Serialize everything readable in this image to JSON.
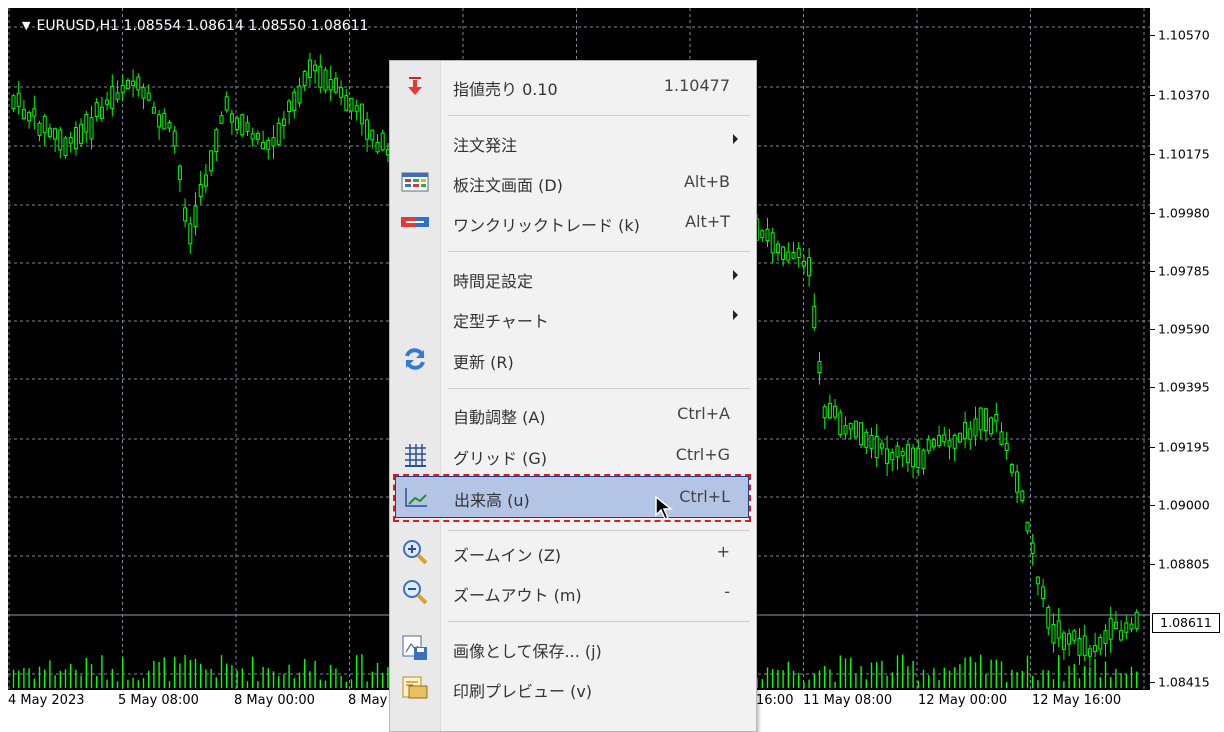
{
  "symbol_info": {
    "text": "EURUSD,H1  1.08554 1.08614 1.08550 1.08611"
  },
  "price_axis": {
    "labels": [
      "1.10570",
      "1.10370",
      "1.10175",
      "1.09980",
      "1.09785",
      "1.09590",
      "1.09395",
      "1.09195",
      "1.09000",
      "1.08805",
      "1.08415"
    ],
    "current_price": "1.08611"
  },
  "time_axis": {
    "labels": [
      "4 May 2023",
      "5 May 08:00",
      "8 May 00:00",
      "8 May",
      "16:00",
      "11 May 08:00",
      "12 May 00:00",
      "12 May 16:00"
    ]
  },
  "colors": {
    "candle": "#00ff00",
    "background": "#000000",
    "grid": "#7a8a99",
    "highlight": "#b4c4e4",
    "highlight_dash": "#e21a1a"
  },
  "menu": {
    "items": [
      {
        "label": "指値売り 0.10",
        "shortcut": "1.10477",
        "icon": "sell-limit-icon"
      },
      {
        "label": "注文発注",
        "submenu": true
      },
      {
        "label": "板注文画面 (D)",
        "shortcut": "Alt+B",
        "icon": "depth-of-market-icon"
      },
      {
        "label": "ワンクリックトレード (k)",
        "shortcut": "Alt+T",
        "icon": "one-click-trade-icon"
      },
      {
        "label": "時間足設定",
        "submenu": true
      },
      {
        "label": "定型チャート",
        "submenu": true
      },
      {
        "label": "更新 (R)",
        "icon": "refresh-icon"
      },
      {
        "label": "自動調整 (A)",
        "shortcut": "Ctrl+A"
      },
      {
        "label": "グリッド (G)",
        "shortcut": "Ctrl+G",
        "icon": "grid-icon",
        "checked": true
      },
      {
        "label": "出来高 (u)",
        "shortcut": "Ctrl+L",
        "icon": "volume-icon",
        "highlighted": true
      },
      {
        "label": "ズームイン (Z)",
        "shortcut": "+",
        "icon": "zoom-in-icon"
      },
      {
        "label": "ズームアウト (m)",
        "shortcut": "-",
        "icon": "zoom-out-icon"
      },
      {
        "label": "画像として保存... (j)",
        "icon": "save-image-icon"
      },
      {
        "label": "印刷プレビュー (v)",
        "icon": "print-preview-icon"
      }
    ]
  }
}
